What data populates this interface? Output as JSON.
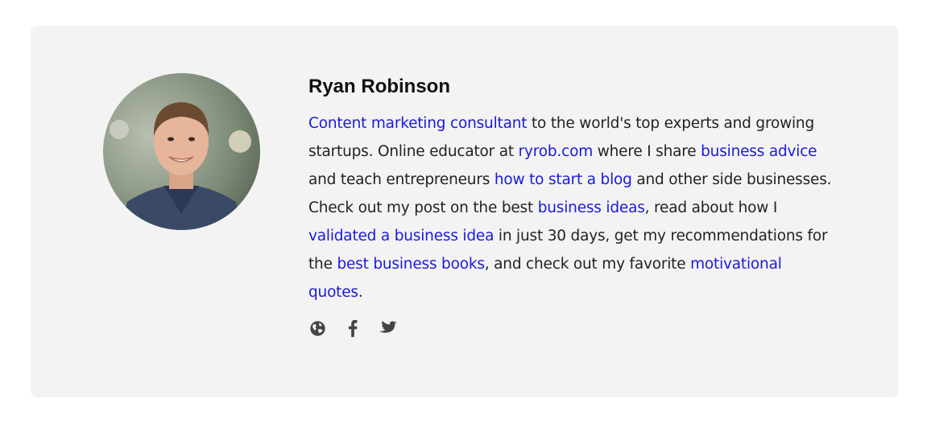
{
  "author": {
    "name": "Ryan Robinson",
    "avatar_alt": "Ryan Robinson",
    "bio": [
      {
        "text": "Content marketing consultant",
        "link": true
      },
      {
        "text": " to the world's top experts and growing startups. Online educator at ",
        "link": false
      },
      {
        "text": "ryrob.com",
        "link": true
      },
      {
        "text": " where I share ",
        "link": false
      },
      {
        "text": "business advice",
        "link": true
      },
      {
        "text": " and teach entrepreneurs ",
        "link": false
      },
      {
        "text": "how to start a blog",
        "link": true
      },
      {
        "text": " and other side businesses. Check out my post on the best ",
        "link": false
      },
      {
        "text": "business ideas",
        "link": true
      },
      {
        "text": ", read about how I ",
        "link": false
      },
      {
        "text": "validated a business idea",
        "link": true
      },
      {
        "text": " in just 30 days, get my recommendations for the ",
        "link": false
      },
      {
        "text": "best business books",
        "link": true
      },
      {
        "text": ", and check out my favorite ",
        "link": false
      },
      {
        "text": "motivational quotes",
        "link": true
      },
      {
        "text": ".",
        "link": false
      }
    ],
    "social": [
      {
        "icon": "globe-icon"
      },
      {
        "icon": "facebook-icon"
      },
      {
        "icon": "twitter-icon"
      }
    ]
  },
  "colors": {
    "card_background": "#f3f3f3",
    "link": "#1a1adb",
    "text": "#222222",
    "icon": "#444444"
  }
}
